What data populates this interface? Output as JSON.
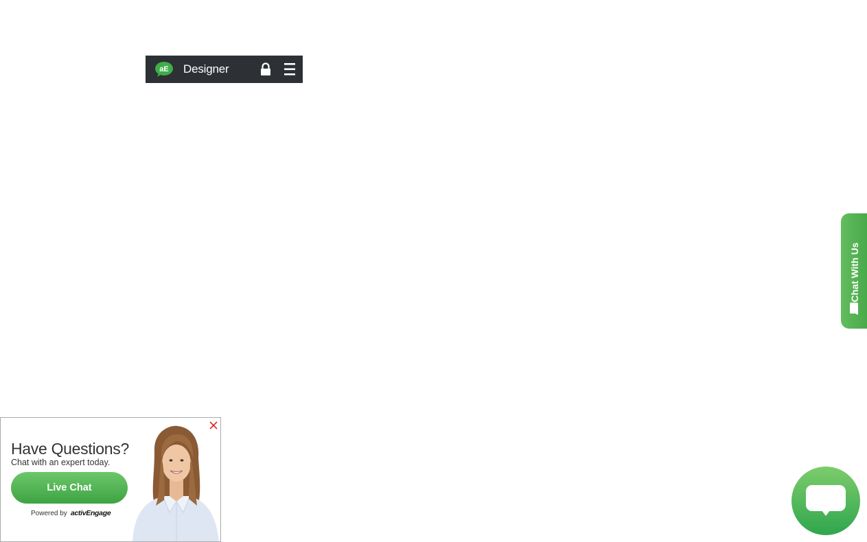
{
  "toolbar": {
    "logo_text": "aE",
    "title": "Designer",
    "lock_icon": "lock-icon",
    "menu_icon": "hamburger-menu-icon",
    "background": "#2d3035",
    "logo_color": "#3fae49"
  },
  "side_tab": {
    "label": "Chat With Us",
    "icon": "chat-bubble-icon",
    "color": "#52b352"
  },
  "invite": {
    "heading": "Have Questions?",
    "subheading": "Chat with an expert today.",
    "button_label": "Live Chat",
    "powered_by": "Powered by",
    "brand": "activEngage",
    "close_icon": "close-icon",
    "close_color": "#e0262b",
    "button_color": "#4eb24f"
  },
  "launcher": {
    "icon": "chat-bubble-icon",
    "color": "#3fae4f"
  }
}
